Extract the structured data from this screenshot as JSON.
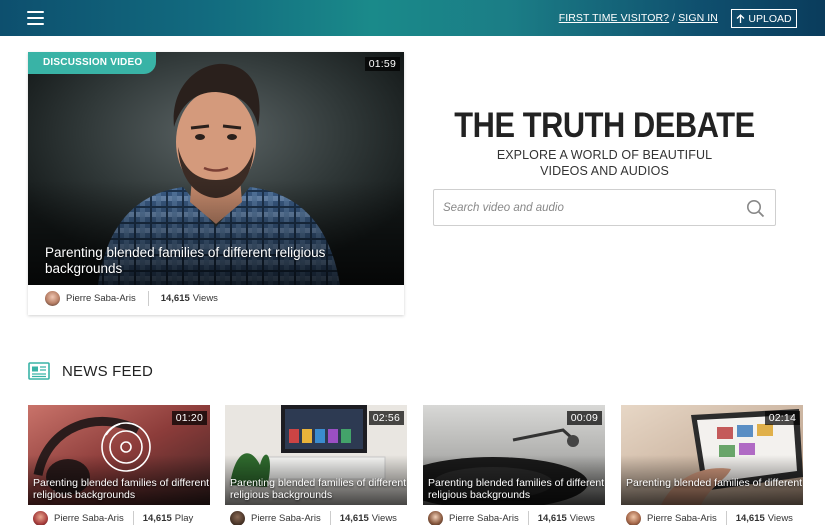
{
  "header": {
    "first_time_label": "FIRST TIME VISITOR?",
    "separator": " / ",
    "sign_in_label": "SIGN IN",
    "upload_label": "UPLOAD"
  },
  "featured": {
    "badge": "DISCUSSION VIDEO",
    "duration": "01:59",
    "title": "Parenting blended families of different religious backgrounds",
    "author": "Pierre Saba-Aris",
    "views_count": "14,615",
    "views_label": "Views"
  },
  "hero": {
    "title": "THE TRUTH DEBATE",
    "subtitle_line1": "EXPLORE A WORLD OF BEAUTIFUL",
    "subtitle_line2": "VIDEOS AND AUDIOS",
    "search_placeholder": "Search video and audio"
  },
  "feed": {
    "title": "NEWS FEED",
    "cards": [
      {
        "duration": "01:20",
        "title": "Parenting blended families of different religious backgrounds",
        "author": "Pierre Saba-Aris",
        "count": "14,615",
        "count_label": "Play"
      },
      {
        "duration": "02:56",
        "title": "Parenting blended families of different religious backgrounds",
        "author": "Pierre Saba-Aris",
        "count": "14,615",
        "count_label": "Views"
      },
      {
        "duration": "00:09",
        "title": "Parenting blended families of different religious backgrounds",
        "author": "Pierre Saba-Aris",
        "count": "14,615",
        "count_label": "Views"
      },
      {
        "duration": "02:14",
        "title": "Parenting blended families of different religious backgrounds",
        "author": "Pierre Saba-Aris",
        "count": "14,615",
        "count_label": "Views"
      }
    ]
  },
  "colors": {
    "accent": "#39b3a6",
    "header_gradient_start": "#0d4f6e",
    "header_gradient_mid": "#1a8a8a"
  },
  "icons": {
    "menu": "hamburger-menu-icon",
    "upload": "arrow-up-icon",
    "search": "magnifier-icon",
    "feed": "newspaper-icon",
    "audio": "vinyl-disc-icon"
  }
}
